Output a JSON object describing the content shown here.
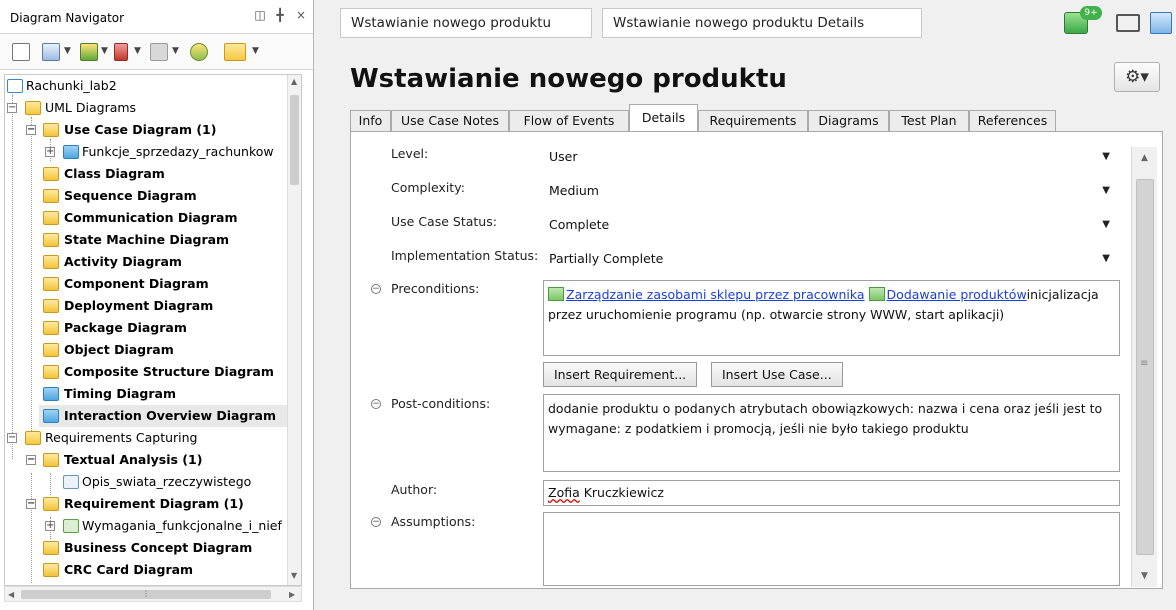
{
  "navigator": {
    "title": "Diagram Navigator",
    "header_icons": [
      "restore-icon",
      "pin-icon",
      "close-icon"
    ],
    "toolbar_icons": [
      "new-diagram-icon",
      "layout-icon",
      "filter-icon",
      "sort-icon",
      "up-icon",
      "refresh-icon",
      "folder-icon"
    ],
    "tree": [
      {
        "label": "Rachunki_lab2",
        "bold": false,
        "icon": "project-icon"
      },
      {
        "label": "UML Diagrams",
        "bold": false,
        "icon": "folder-icon"
      },
      {
        "label": "Use Case Diagram (1)",
        "bold": true,
        "icon": "use-case-diagram-icon"
      },
      {
        "label": "Funkcje_sprzedazy_rachunkow",
        "bold": false,
        "icon": "diagram-file-icon"
      },
      {
        "label": "Class Diagram",
        "bold": true,
        "icon": "class-diagram-icon"
      },
      {
        "label": "Sequence Diagram",
        "bold": true,
        "icon": "sequence-diagram-icon"
      },
      {
        "label": "Communication Diagram",
        "bold": true,
        "icon": "communication-diagram-icon"
      },
      {
        "label": "State Machine Diagram",
        "bold": true,
        "icon": "state-machine-diagram-icon"
      },
      {
        "label": "Activity Diagram",
        "bold": true,
        "icon": "activity-diagram-icon"
      },
      {
        "label": "Component Diagram",
        "bold": true,
        "icon": "component-diagram-icon"
      },
      {
        "label": "Deployment Diagram",
        "bold": true,
        "icon": "deployment-diagram-icon"
      },
      {
        "label": "Package Diagram",
        "bold": true,
        "icon": "package-diagram-icon"
      },
      {
        "label": "Object Diagram",
        "bold": true,
        "icon": "object-diagram-icon"
      },
      {
        "label": "Composite Structure Diagram",
        "bold": true,
        "icon": "composite-structure-diagram-icon"
      },
      {
        "label": "Timing Diagram",
        "bold": true,
        "icon": "timing-diagram-icon"
      },
      {
        "label": "Interaction Overview Diagram",
        "bold": true,
        "icon": "interaction-overview-diagram-icon"
      },
      {
        "label": "Requirements Capturing",
        "bold": false,
        "icon": "folder-icon"
      },
      {
        "label": "Textual Analysis (1)",
        "bold": true,
        "icon": "textual-analysis-icon"
      },
      {
        "label": "Opis_swiata_rzeczywistego",
        "bold": false,
        "icon": "document-icon"
      },
      {
        "label": "Requirement Diagram (1)",
        "bold": true,
        "icon": "requirement-diagram-icon"
      },
      {
        "label": "Wymagania_funkcjonalne_i_nief",
        "bold": false,
        "icon": "requirement-file-icon"
      },
      {
        "label": "Business Concept Diagram",
        "bold": true,
        "icon": "business-concept-diagram-icon"
      },
      {
        "label": "CRC Card Diagram",
        "bold": true,
        "icon": "crc-card-diagram-icon"
      }
    ]
  },
  "breadcrumb": [
    "Wstawianie nowego produktu",
    "Wstawianie nowego produktu Details"
  ],
  "top_icons": {
    "notification_badge": "9+",
    "icons": [
      "megaphone-icon",
      "layout-toggle-icon",
      "window-icon"
    ]
  },
  "page_title": "Wstawianie nowego produktu",
  "tabs": [
    "Info",
    "Use Case Notes",
    "Flow of Events",
    "Details",
    "Requirements",
    "Diagrams",
    "Test Plan",
    "References"
  ],
  "active_tab": "Details",
  "details": {
    "level": {
      "label": "Level:",
      "value": "User"
    },
    "complexity": {
      "label": "Complexity:",
      "value": "Medium"
    },
    "use_case_status": {
      "label": "Use Case Status:",
      "value": "Complete"
    },
    "implementation_status": {
      "label": "Implementation Status:",
      "value": "Partially Complete"
    },
    "preconditions": {
      "label": "Preconditions:",
      "link1": "Zarządzanie zasobami sklepu przez pracownika",
      "link2": "Dodawanie produktów",
      "text_after": "inicjalizacja",
      "text_line2": "przez uruchomienie programu (np. otwarcie strony WWW, start aplikacji)"
    },
    "insert_requirement_button": "Insert Requirement...",
    "insert_use_case_button": "Insert Use Case...",
    "postconditions": {
      "label": "Post-conditions:",
      "line1": "dodanie produktu o podanych atrybutach obowiązkowych: nazwa i cena oraz jeśli jest to",
      "line2": "wymagane: z podatkiem i promocją, jeśli nie było takiego produktu"
    },
    "author": {
      "label": "Author:",
      "value_first": "Zofia",
      "value_last": " Kruczkiewicz"
    },
    "assumptions": {
      "label": "Assumptions:",
      "value": ""
    }
  },
  "colors": {
    "link": "#1a3fd6",
    "accent_folder": "#f4c840",
    "accent_diagram": "#4fa7e2"
  }
}
